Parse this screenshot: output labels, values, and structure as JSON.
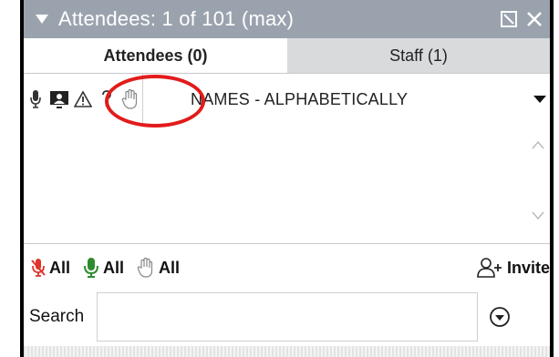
{
  "window": {
    "title": "Attendees:  1 of 101 (max)"
  },
  "tabs": [
    {
      "label": "Attendees (0)",
      "active": true
    },
    {
      "label": "Staff (1)",
      "active": false
    }
  ],
  "toolbar": {
    "icons": [
      "microphone-icon",
      "webcam-icon",
      "warning-icon",
      "question-icon",
      "raised-hand-icon"
    ],
    "sort_label": "NAMES - ALPHABETICALLY"
  },
  "actions": {
    "mute_all_label": "All",
    "unmute_all_label": "All",
    "lower_hands_label": "All",
    "invite_label": "Invite"
  },
  "search": {
    "label": "Search",
    "value": "",
    "placeholder": ""
  },
  "colors": {
    "titlebar": "#9aa3ad",
    "tab_inactive": "#d8dadc",
    "highlight": "#e21b1b",
    "mute_red": "#e0342a",
    "mic_green": "#2e8b2e"
  }
}
